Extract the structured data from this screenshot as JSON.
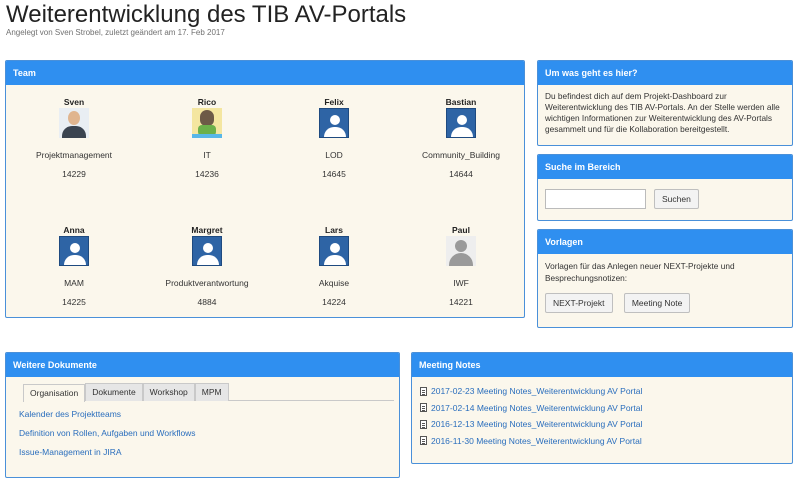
{
  "page": {
    "title": "Weiterentwicklung des TIB AV-Portals",
    "byline": "Angelegt von Sven Strobel, zuletzt geändert am 17. Feb 2017"
  },
  "team": {
    "heading": "Team",
    "members": [
      {
        "name": "Sven",
        "role": "Projektmanagement",
        "number": "14229",
        "avatar": "photo-avatar"
      },
      {
        "name": "Rico",
        "role": "IT",
        "number": "14236",
        "avatar": "cartoon-avatar"
      },
      {
        "name": "Felix",
        "role": "LOD",
        "number": "14645",
        "avatar": "default-user-avatar"
      },
      {
        "name": "Bastian",
        "role": "Community_Building",
        "number": "14644",
        "avatar": "default-user-avatar"
      },
      {
        "name": "Anna",
        "role": "MAM",
        "number": "14225",
        "avatar": "default-user-avatar"
      },
      {
        "name": "Margret",
        "role": "Produktverantwortung",
        "number": "4884",
        "avatar": "default-user-avatar"
      },
      {
        "name": "Lars",
        "role": "Akquise",
        "number": "14224",
        "avatar": "default-user-avatar"
      },
      {
        "name": "Paul",
        "role": "IWF",
        "number": "14221",
        "avatar": "grey-user-avatar"
      }
    ]
  },
  "about": {
    "heading": "Um was geht es hier?",
    "text": "Du befindest dich auf dem Projekt-Dashboard zur Weiterentwicklung des TIB AV-Portals. An der Stelle werden alle wichtigen Informationen zur Weiterentwicklung des AV-Portals gesammelt und für die Kollaboration bereitgestellt."
  },
  "search": {
    "heading": "Suche im Bereich",
    "input_value": "",
    "button_label": "Suchen"
  },
  "templates": {
    "heading": "Vorlagen",
    "text": "Vorlagen für das Anlegen neuer NEXT-Projekte und Besprechungsnotizen:",
    "buttons": [
      "NEXT-Projekt",
      "Meeting Note"
    ]
  },
  "docs": {
    "heading": "Weitere Dokumente",
    "tabs": [
      "Organisation",
      "Dokumente",
      "Workshop",
      "MPM"
    ],
    "active_tab": "Organisation",
    "links": [
      "Kalender des Projektteams",
      "Definition von Rollen, Aufgaben und Workflows",
      "Issue-Management in JIRA"
    ]
  },
  "notes": {
    "heading": "Meeting Notes",
    "items": [
      "2017-02-23 Meeting Notes_Weiterentwicklung AV Portal",
      "2017-02-14 Meeting Notes_Weiterentwicklung AV Portal",
      "2016-12-13 Meeting Notes_Weiterentwicklung AV Portal",
      "2016-11-30 Meeting Notes_Weiterentwicklung AV Portal"
    ],
    "icon": "file-icon"
  },
  "colors": {
    "panel_header": "#2f8ff0",
    "panel_body": "#fbf7ec",
    "link": "#2a6ebd"
  }
}
